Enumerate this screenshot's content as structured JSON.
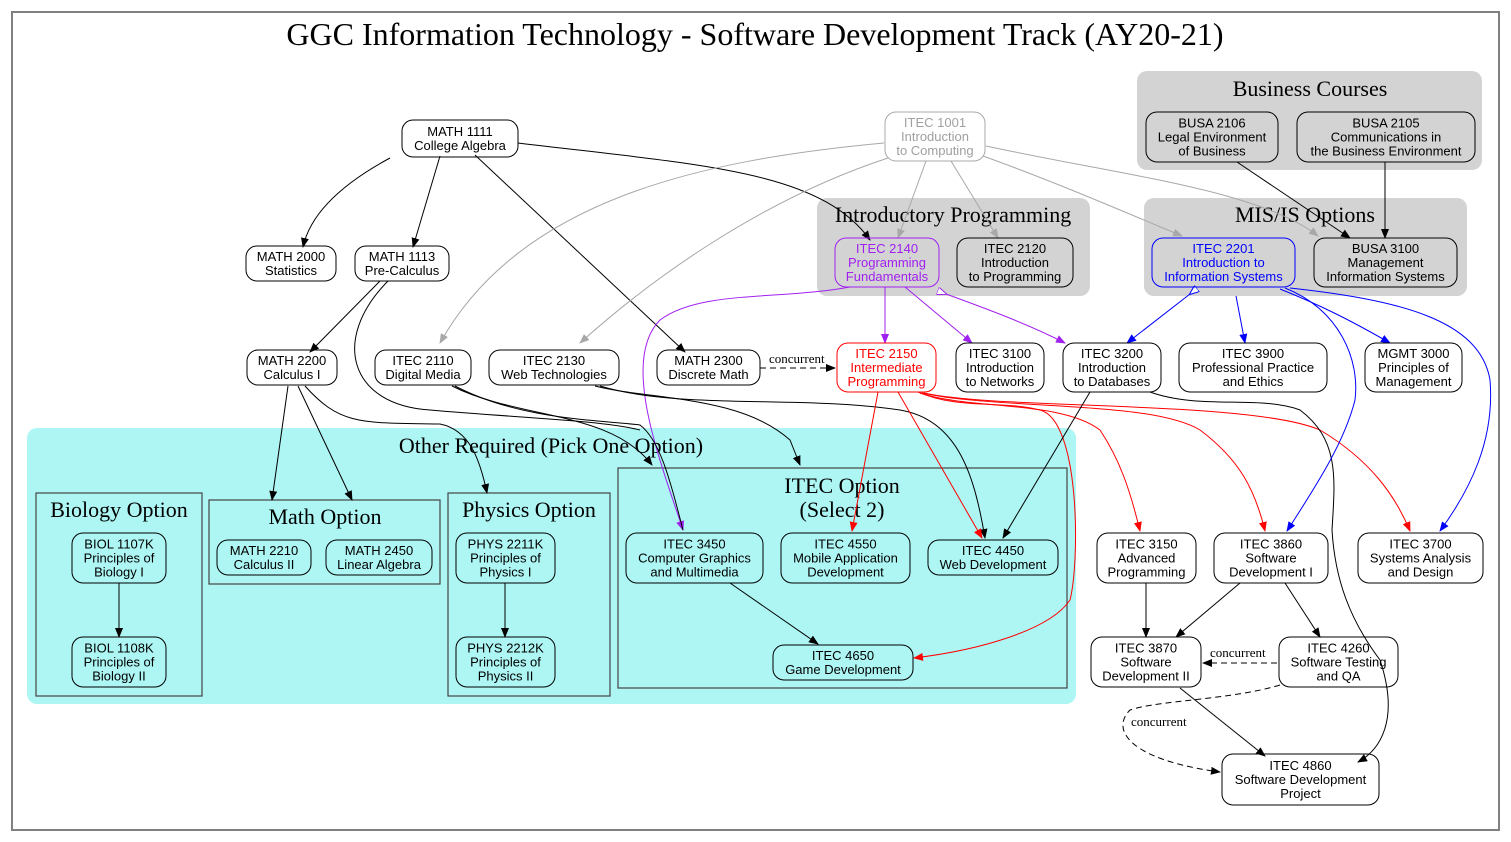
{
  "title": "GGC Information Technology - Software Development Track (AY20-21)",
  "colors": {
    "prereq": "#000000",
    "itec1001": "#a8a8a8",
    "itec2140": "#a020f0",
    "itec2201": "#0000ff",
    "itec2150": "#ff0000",
    "cluster_gray": "#d3d3d3",
    "cluster_cyan": "#adf6f4"
  },
  "clusters": {
    "business": "Business Courses",
    "intro_programming": "Introductory Programming",
    "mis_is": "MIS/IS Options",
    "other_required": "Other Required (Pick One Option)",
    "biology": "Biology Option",
    "math": "Math Option",
    "physics": "Physics Option",
    "itec_option_line1": "ITEC Option",
    "itec_option_line2": "(Select 2)"
  },
  "nodes": {
    "math1111": [
      "MATH 1111",
      "College Algebra"
    ],
    "itec1001": [
      "ITEC 1001",
      "Introduction",
      "to Computing"
    ],
    "busa2106": [
      "BUSA 2106",
      "Legal Environment",
      "of Business"
    ],
    "busa2105": [
      "BUSA 2105",
      "Communications in",
      "the Business Environment"
    ],
    "math2000": [
      "MATH 2000",
      "Statistics"
    ],
    "math1113": [
      "MATH 1113",
      "Pre-Calculus"
    ],
    "itec2140": [
      "ITEC 2140",
      "Programming",
      "Fundamentals"
    ],
    "itec2120": [
      "ITEC 2120",
      "Introduction",
      "to Programming"
    ],
    "itec2201": [
      "ITEC 2201",
      "Introduction to",
      "Information Systems"
    ],
    "busa3100": [
      "BUSA 3100",
      "Management",
      "Information Systems"
    ],
    "math2200": [
      "MATH 2200",
      "Calculus I"
    ],
    "itec2110": [
      "ITEC 2110",
      "Digital Media"
    ],
    "itec2130": [
      "ITEC 2130",
      "Web Technologies"
    ],
    "math2300": [
      "MATH 2300",
      "Discrete Math"
    ],
    "itec2150": [
      "ITEC 2150",
      "Intermediate",
      "Programming"
    ],
    "itec3100": [
      "ITEC 3100",
      "Introduction",
      "to Networks"
    ],
    "itec3200": [
      "ITEC 3200",
      "Introduction",
      "to Databases"
    ],
    "itec3900": [
      "ITEC 3900",
      "Professional Practice",
      "and Ethics"
    ],
    "mgmt3000": [
      "MGMT 3000",
      "Principles of",
      "Management"
    ],
    "biol1107k": [
      "BIOL 1107K",
      "Principles of",
      "Biology I"
    ],
    "biol1108k": [
      "BIOL 1108K",
      "Principles of",
      "Biology II"
    ],
    "math2210": [
      "MATH 2210",
      "Calculus II"
    ],
    "math2450": [
      "MATH 2450",
      "Linear Algebra"
    ],
    "phys2211k": [
      "PHYS 2211K",
      "Principles of",
      "Physics I"
    ],
    "phys2212k": [
      "PHYS 2212K",
      "Principles of",
      "Physics II"
    ],
    "itec3450": [
      "ITEC 3450",
      "Computer Graphics",
      "and Multimedia"
    ],
    "itec4550": [
      "ITEC 4550",
      "Mobile Application",
      "Development"
    ],
    "itec4450": [
      "ITEC 4450",
      "Web Development"
    ],
    "itec4650": [
      "ITEC 4650",
      "Game Development"
    ],
    "itec3150": [
      "ITEC 3150",
      "Advanced",
      "Programming"
    ],
    "itec3860": [
      "ITEC 3860",
      "Software",
      "Development I"
    ],
    "itec3700": [
      "ITEC 3700",
      "Systems Analysis",
      "and Design"
    ],
    "itec3870": [
      "ITEC 3870",
      "Software",
      "Development II"
    ],
    "itec4260": [
      "ITEC 4260",
      "Software Testing",
      "and QA"
    ],
    "itec4860": [
      "ITEC 4860",
      "Software Development",
      "Project"
    ]
  },
  "edge_labels": {
    "math2300_itec2150": "concurrent",
    "itec4260_itec3870": "concurrent",
    "itec4260_itec4860": "concurrent"
  }
}
